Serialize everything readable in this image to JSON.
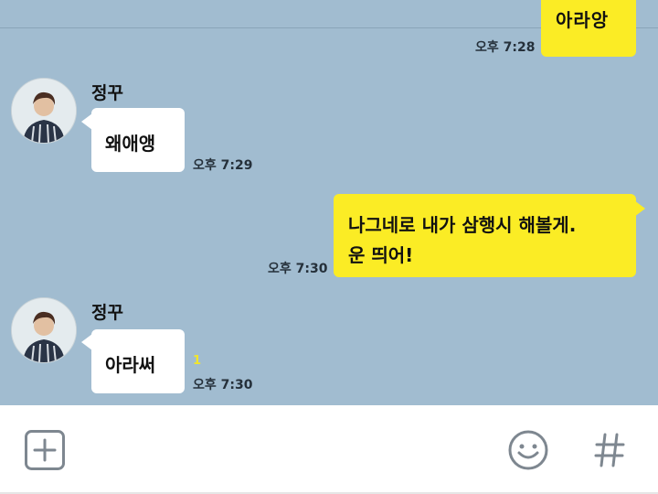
{
  "messages": [
    {
      "type": "outgoing",
      "text": "아라앙",
      "time": "오후 7:28"
    },
    {
      "type": "incoming",
      "sender": "정꾸",
      "text": "왜애앵",
      "time": "오후 7:29"
    },
    {
      "type": "outgoing",
      "text_line1": "나그네로 내가 삼행시 해볼게.",
      "text_line2": "운 띄어!",
      "time": "오후 7:30"
    },
    {
      "type": "incoming",
      "sender": "정꾸",
      "text": "아라써",
      "time": "오후 7:30",
      "unread": "1"
    }
  ],
  "input_bar": {
    "left_icon": "plus-box-icon",
    "right_icons": [
      "emoji-icon",
      "hash-icon"
    ]
  },
  "colors": {
    "chat_background": "#a1bcd0",
    "outgoing_bubble": "#fbec25",
    "incoming_bubble": "#ffffff",
    "unread_count": "#f2e62a"
  }
}
